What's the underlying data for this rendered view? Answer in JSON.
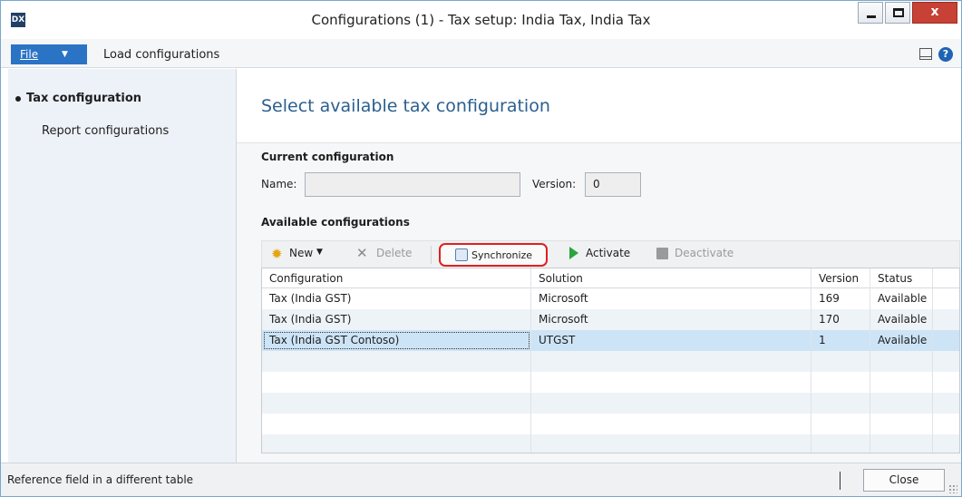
{
  "window": {
    "title": "Configurations (1) - Tax setup: India Tax, India Tax",
    "app_icon_text": "DX",
    "close_glyph": "x"
  },
  "menubar": {
    "file_label": "File",
    "load_configurations": "Load configurations",
    "help_glyph": "?"
  },
  "nav": {
    "items": [
      {
        "label": "Tax configuration",
        "active": true
      },
      {
        "label": "Report configurations",
        "active": false
      }
    ]
  },
  "page": {
    "heading": "Select available tax configuration"
  },
  "current_configuration": {
    "title": "Current configuration",
    "name_label": "Name:",
    "name_value": "",
    "version_label": "Version:",
    "version_value": "0"
  },
  "available_configurations": {
    "title": "Available configurations",
    "actions": {
      "new": "New",
      "delete": "Delete",
      "synchronize": "Synchronize",
      "activate": "Activate",
      "deactivate": "Deactivate"
    },
    "columns": [
      "Configuration",
      "Solution",
      "Version",
      "Status"
    ],
    "rows": [
      {
        "configuration": "Tax (India GST)",
        "solution": "Microsoft",
        "version": "169",
        "status": "Available"
      },
      {
        "configuration": "Tax (India GST)",
        "solution": "Microsoft",
        "version": "170",
        "status": "Available"
      },
      {
        "configuration": "Tax (India GST Contoso)",
        "solution": "UTGST",
        "version": "1",
        "status": "Available",
        "selected": true
      }
    ]
  },
  "statusbar": {
    "text": "Reference field in a different table",
    "close_label": "Close"
  },
  "colors": {
    "accent": "#2a73c5",
    "heading": "#2b5f8f",
    "highlight": "#e02020",
    "selected_row": "#cde4f7"
  }
}
